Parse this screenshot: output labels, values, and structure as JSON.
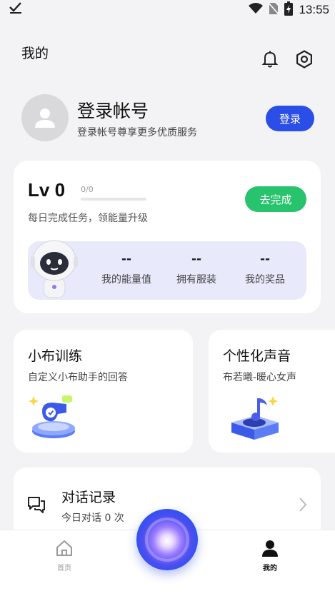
{
  "status_bar": {
    "time": "13:55"
  },
  "header": {
    "title": "我的"
  },
  "login": {
    "title": "登录帐号",
    "subtitle": "登录帐号尊享更多优质服务",
    "button_label": "登录"
  },
  "level": {
    "label": "Lv 0",
    "progress_text": "0/0",
    "progress_fraction": 0,
    "description": "每日完成任务，领能量升级",
    "complete_button": "去完成",
    "stats": [
      {
        "value": "--",
        "label": "我的能量值"
      },
      {
        "value": "--",
        "label": "拥有服装"
      },
      {
        "value": "--",
        "label": "我的奖品"
      }
    ]
  },
  "cards": {
    "training": {
      "title": "小布训练",
      "subtitle": "自定义小布助手的回答"
    },
    "voice": {
      "title": "个性化声音",
      "subtitle": "布若曦-暖心女声"
    }
  },
  "history": {
    "title": "对话记录",
    "subtitle": "今日对话 0 次"
  },
  "tabs": [
    {
      "label": "首页",
      "icon": "home-icon"
    },
    {
      "label": "我的",
      "icon": "person-icon"
    }
  ],
  "colors": {
    "accent_blue": "#2b4ee6",
    "accent_green": "#27c36d",
    "stats_panel": "#e8eafc"
  }
}
